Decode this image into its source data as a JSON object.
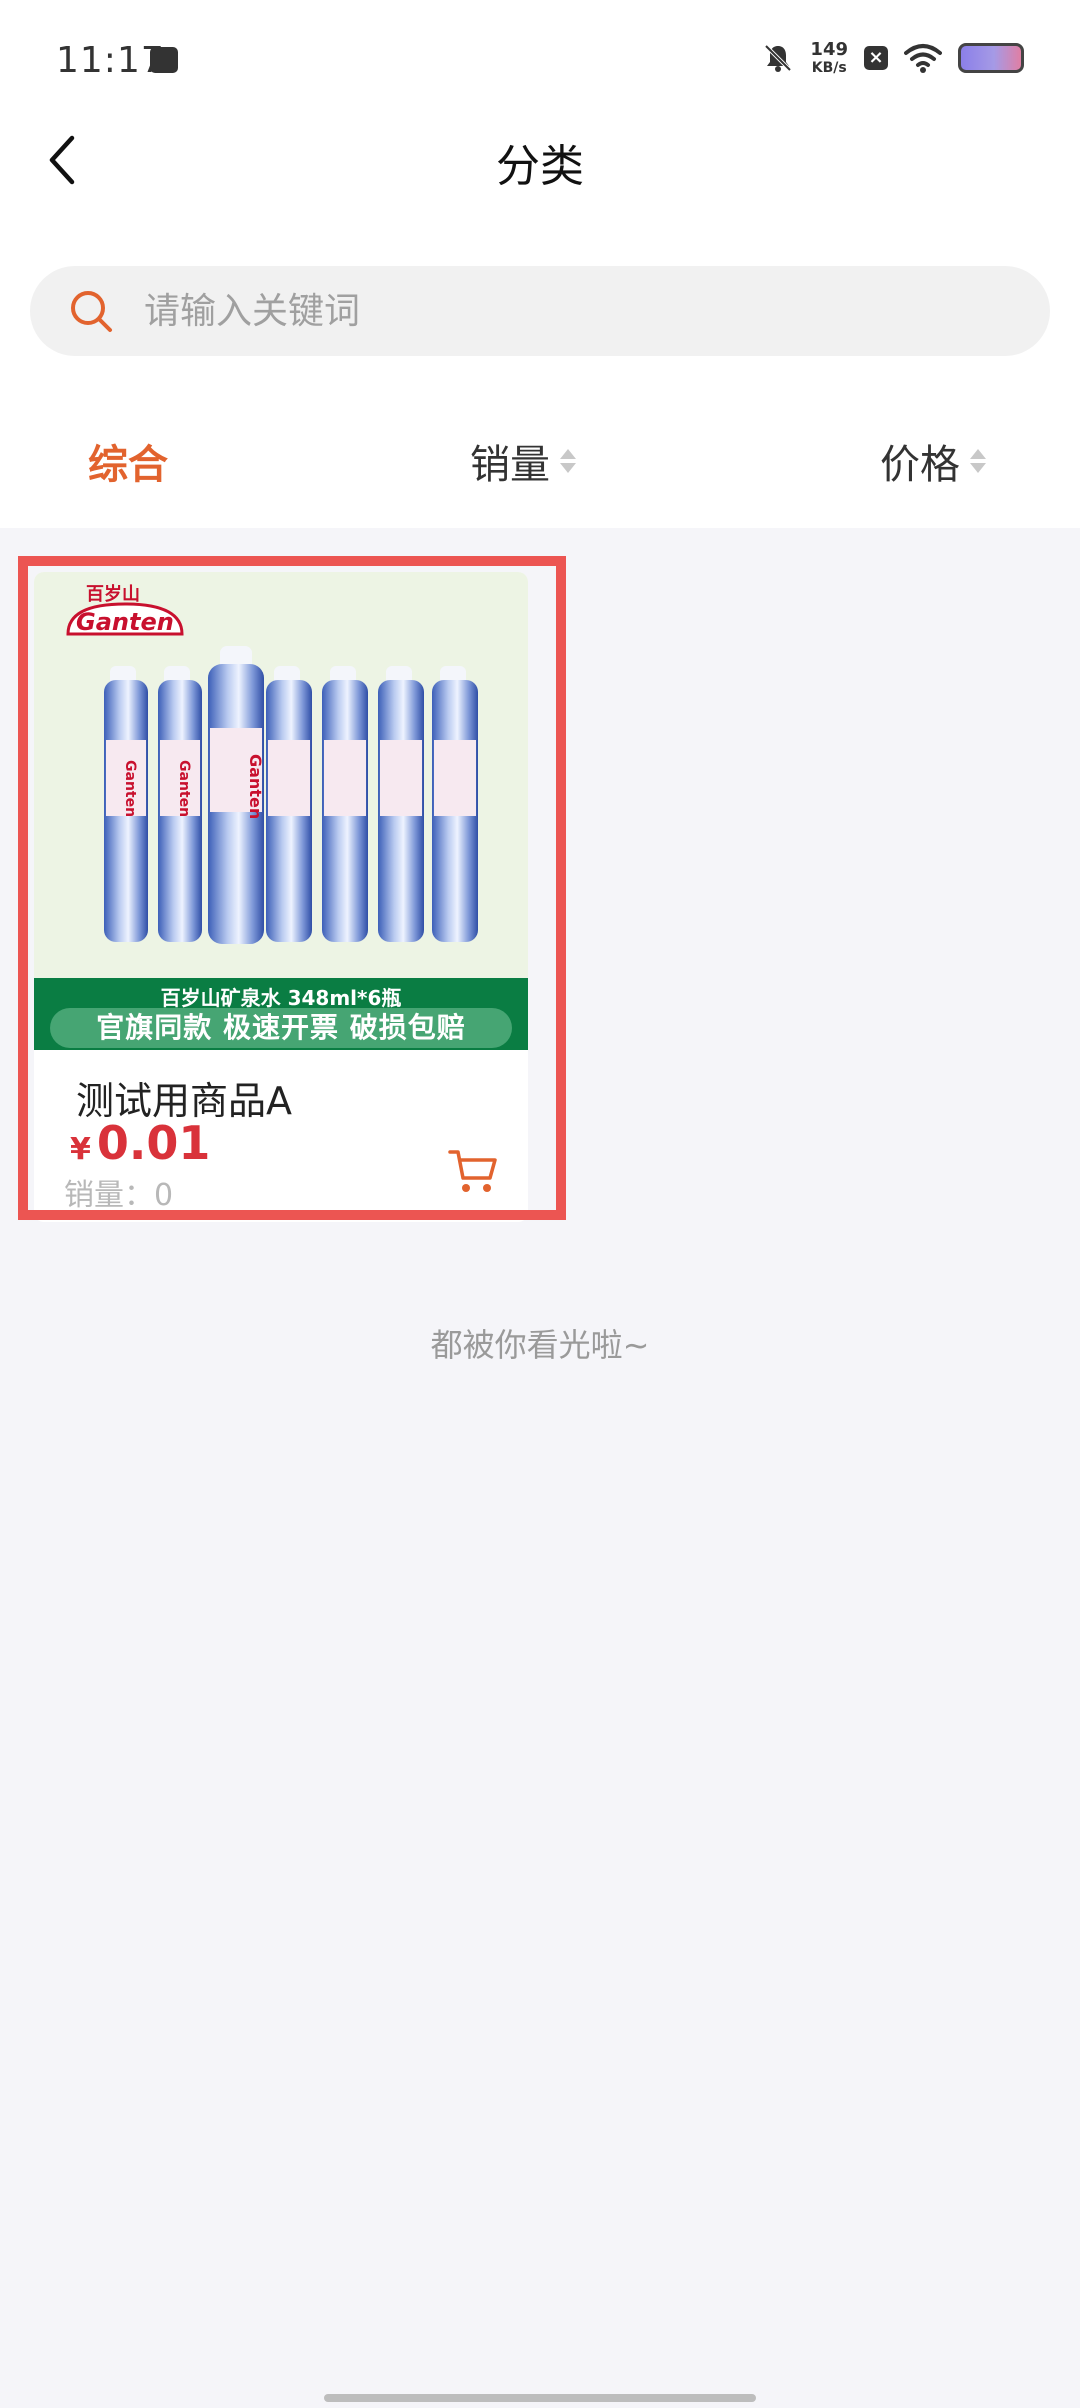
{
  "status_bar": {
    "time": "11:17",
    "net_speed_value": "149",
    "net_speed_unit": "KB/s"
  },
  "header": {
    "title": "分类",
    "back_icon": "chevron-left-icon"
  },
  "search": {
    "placeholder": "请输入关键词",
    "icon": "search-icon"
  },
  "sort_tabs": [
    {
      "label": "综合",
      "active": true
    },
    {
      "label": "销量",
      "active": false
    },
    {
      "label": "价格",
      "active": false
    }
  ],
  "products": [
    {
      "image": {
        "brand_cn": "百岁山",
        "brand_en": "Ganten",
        "banner_top": "百岁山矿泉水 348ml*6瓶",
        "banner_bottom": "官旗同款 极速开票 破损包赔"
      },
      "name": "测试用商品A",
      "price_symbol": "¥",
      "price": "0.01",
      "sales": "销量：0"
    }
  ],
  "list_end": "都被你看光啦~",
  "colors": {
    "accent": "#e2632e",
    "price": "#d9323a",
    "highlight": "#ec5552",
    "background": "#f5f5f9"
  }
}
